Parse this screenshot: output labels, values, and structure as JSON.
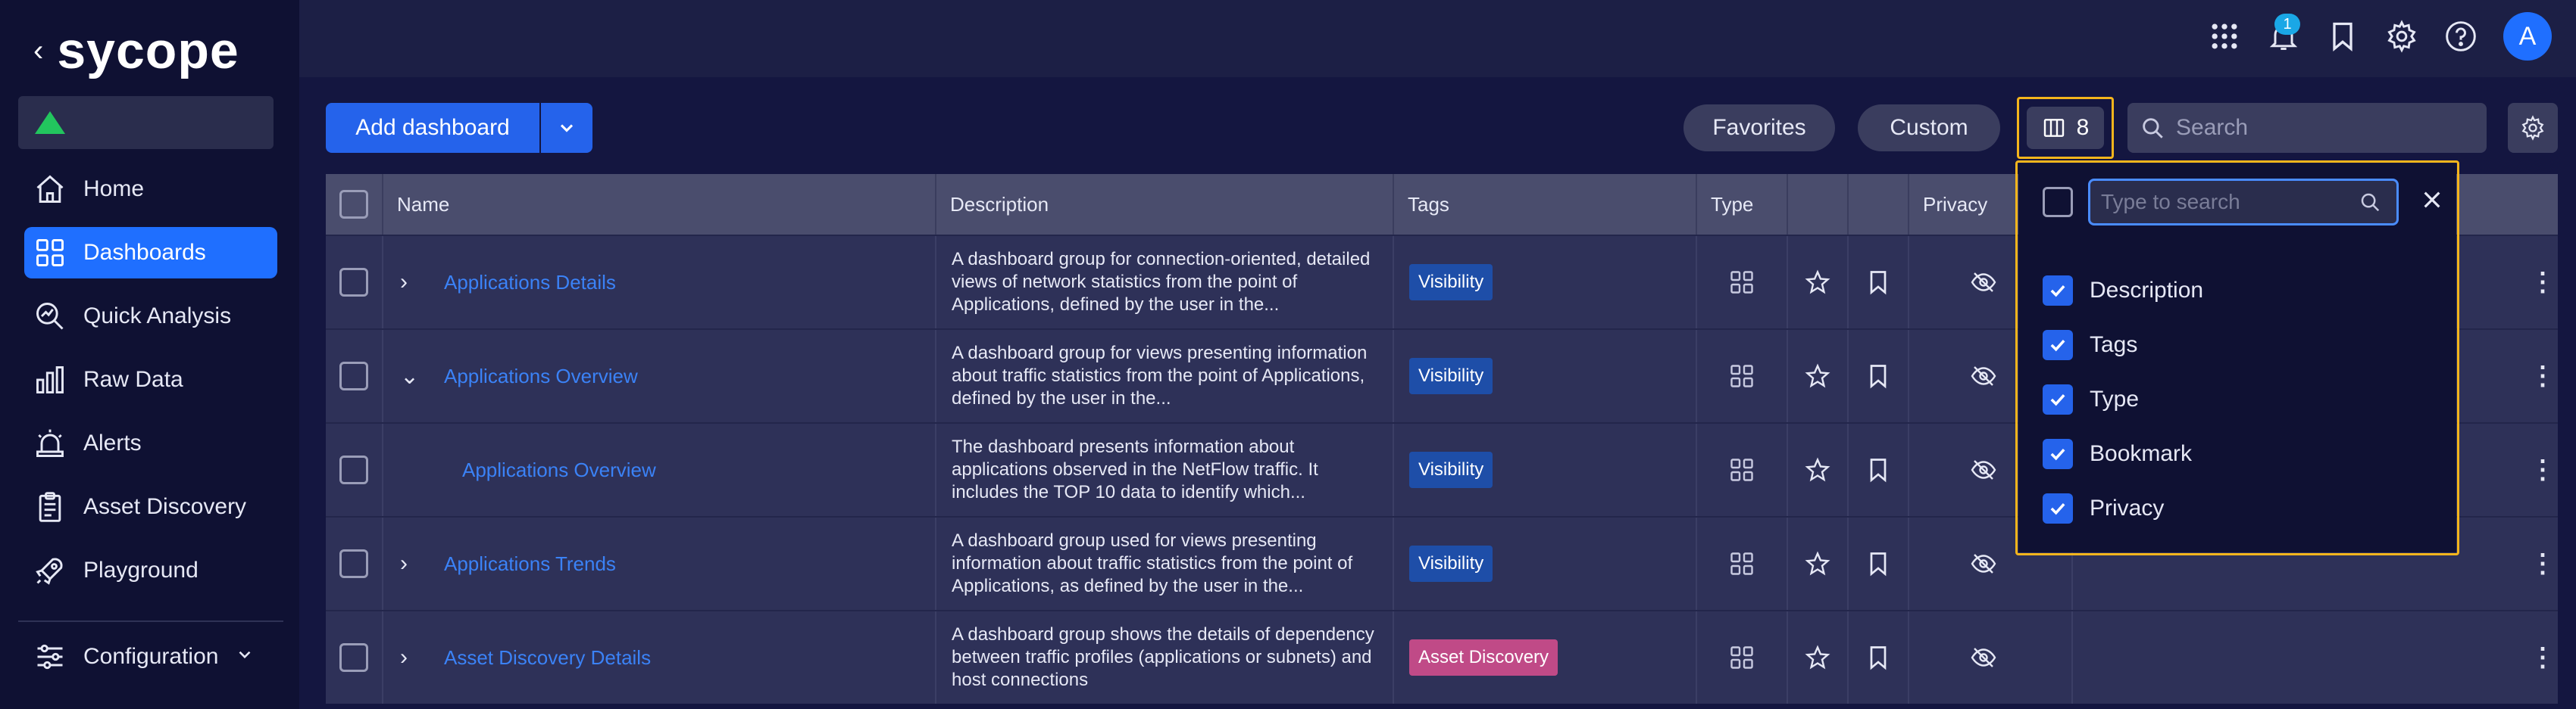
{
  "app": {
    "back_glyph": "‹",
    "brand": "sycope"
  },
  "sidebar": {
    "items": [
      {
        "label": "Home",
        "icon": "home-icon"
      },
      {
        "label": "Dashboards",
        "icon": "dashboards-icon"
      },
      {
        "label": "Quick Analysis",
        "icon": "quick-analysis-icon"
      },
      {
        "label": "Raw Data",
        "icon": "raw-data-icon"
      },
      {
        "label": "Alerts",
        "icon": "alerts-icon"
      },
      {
        "label": "Asset Discovery",
        "icon": "asset-discovery-icon"
      },
      {
        "label": "Playground",
        "icon": "playground-icon"
      }
    ],
    "config_label": "Configuration"
  },
  "topbar": {
    "notification_count": "1",
    "avatar_initial": "A"
  },
  "toolbar": {
    "add_label": "Add dashboard",
    "favorites_label": "Favorites",
    "custom_label": "Custom",
    "columns_count": "8",
    "search_placeholder": "Search"
  },
  "table": {
    "headers": {
      "name": "Name",
      "description": "Description",
      "tags": "Tags",
      "type": "Type",
      "privacy": "Privacy"
    },
    "rows": [
      {
        "name": "Applications Details",
        "expand": "›",
        "description": "A dashboard group for connection-oriented, detailed views of network statistics from the point of Applications, defined by the user in the...",
        "tag": "Visibility"
      },
      {
        "name": "Applications Overview",
        "expand": "⌄",
        "description": "A dashboard group for views presenting information about traffic statistics from the point of Applications, defined by the user in the...",
        "tag": "Visibility"
      },
      {
        "name": "Applications Overview",
        "expand": "",
        "description": "The dashboard presents information about applications observed in the NetFlow traffic. It includes the TOP 10 data to identify which...",
        "tag": "Visibility"
      },
      {
        "name": "Applications Trends",
        "expand": "›",
        "description": "A dashboard group used for views presenting information about traffic statistics from the point of Applications, as defined by the user in the...",
        "tag": "Visibility"
      },
      {
        "name": "Asset Discovery Details",
        "expand": "›",
        "description": "A dashboard group shows the details of dependency between traffic profiles (applications or subnets) and host connections",
        "tag": "Asset Discovery"
      }
    ]
  },
  "columns_dropdown": {
    "search_placeholder": "Type to search",
    "items": [
      {
        "label": "Description",
        "checked": true
      },
      {
        "label": "Tags",
        "checked": true
      },
      {
        "label": "Type",
        "checked": true
      },
      {
        "label": "Bookmark",
        "checked": true
      },
      {
        "label": "Privacy",
        "checked": true
      }
    ]
  },
  "colors": {
    "accent": "#2563eb",
    "highlight_outline": "#f5b51c",
    "link": "#3b82f6",
    "status_ok": "#22c55e",
    "tag_asset_discovery": "#c04a87"
  }
}
